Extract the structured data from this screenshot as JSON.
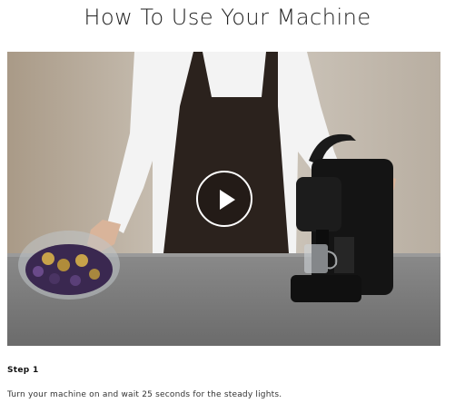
{
  "page": {
    "title": "How To Use Your Machine"
  },
  "video": {
    "play_icon": "play-icon",
    "colors": {
      "wall": "#c8c1b6",
      "counter": "#7d7d7d",
      "machine": "#141414",
      "apron": "#2a211c",
      "shirt": "#f4f4f4"
    }
  },
  "step": {
    "heading": "Step 1",
    "text": "Turn your machine on and wait 25 seconds for the steady lights."
  }
}
